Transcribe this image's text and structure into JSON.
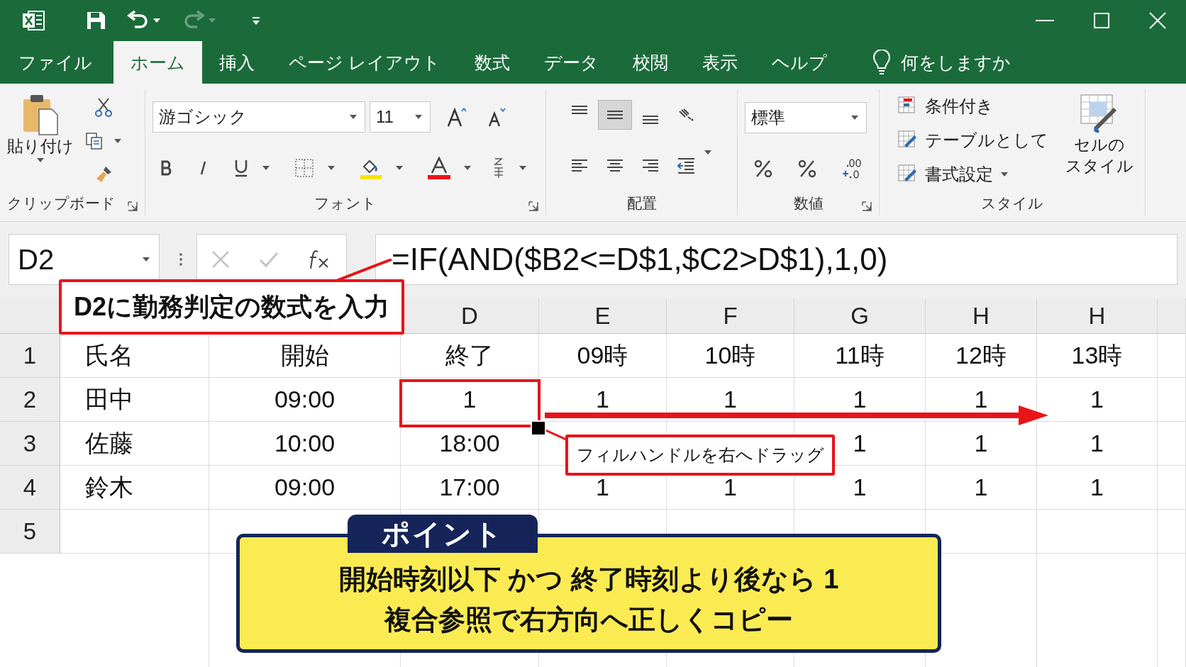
{
  "title_bar": {
    "redo": {
      "disabled": true
    }
  },
  "tabs": [
    {
      "label": "ファイル",
      "selected": false
    },
    {
      "label": "ホーム",
      "selected": true
    },
    {
      "label": "挿入",
      "selected": false
    },
    {
      "label": "ページ レイアウト",
      "selected": false
    },
    {
      "label": "数式",
      "selected": false
    },
    {
      "label": "データ",
      "selected": false
    },
    {
      "label": "校閲",
      "selected": false
    },
    {
      "label": "表示",
      "selected": false
    },
    {
      "label": "ヘルプ",
      "selected": false
    }
  ],
  "tell_me": {
    "placeholder": "何をしますか"
  },
  "ribbon": {
    "clipboard": {
      "paste": "貼り付け",
      "label": "クリップボード"
    },
    "font": {
      "name": "游ゴシック",
      "size": "11",
      "label": "フォント"
    },
    "alignment": {
      "label": "配置",
      "buttons": [
        {
          "kind": "top",
          "selected": false
        },
        {
          "kind": "middle",
          "selected": true
        },
        {
          "kind": "bottom",
          "selected": false
        },
        {
          "kind": "orientation",
          "selected": false
        },
        {
          "kind": "left",
          "selected": false
        },
        {
          "kind": "center",
          "selected": false
        },
        {
          "kind": "right",
          "selected": false
        },
        {
          "kind": "indent",
          "selected": false
        }
      ]
    },
    "number": {
      "format": "標準",
      "label": "数値"
    },
    "styles": {
      "items": [
        "条件付き",
        "テーブルとして",
        "書式設定"
      ],
      "cell_styles": [
        "セルの",
        "スタイル"
      ],
      "label": "スタイル"
    }
  },
  "formula_bar": {
    "name_box": "D2",
    "formula": "=IF(AND($B2<=D$1,$C2>D$1),1,0)"
  },
  "sheet": {
    "column_headers": [
      "D",
      "E",
      "F",
      "G",
      "H",
      "H"
    ],
    "rows": [
      {
        "number": "1",
        "cells": [
          {
            "text": "氏名"
          },
          {
            "text": "開始"
          },
          {
            "text": "終了"
          },
          {
            "text": "09時"
          },
          {
            "text": "10時"
          },
          {
            "text": "11時"
          },
          {
            "text": "12時"
          },
          {
            "text": "13時"
          }
        ]
      },
      {
        "number": "2",
        "cells": [
          {
            "text": "田中"
          },
          {
            "text": "09:00"
          },
          {
            "text": "1"
          },
          {
            "text": "1"
          },
          {
            "text": "1"
          },
          {
            "text": "1"
          },
          {
            "text": "1"
          },
          {
            "text": "1"
          }
        ]
      },
      {
        "number": "3",
        "cells": [
          {
            "text": "佐藤"
          },
          {
            "text": "10:00"
          },
          {
            "text": "18:00"
          },
          {},
          {},
          {
            "text": "1"
          },
          {
            "text": "1"
          },
          {
            "text": "1"
          }
        ]
      },
      {
        "number": "4",
        "cells": [
          {
            "text": "鈴木"
          },
          {
            "text": "09:00"
          },
          {
            "text": "17:00"
          },
          {
            "text": "1"
          },
          {
            "text": "1"
          },
          {
            "text": "1"
          },
          {
            "text": "1"
          },
          {
            "text": "1"
          }
        ]
      },
      {
        "number": "5",
        "cells": []
      }
    ]
  },
  "annotations": {
    "formula_callout": "D2に勤務判定の数式を入力",
    "drag_callout": "フィルハンドルを右へドラッグ",
    "point": {
      "badge": "ポイント",
      "lines": [
        "開始時刻以下 かつ 終了時刻より後なら 1",
        "複合参照で右方向へ正しくコピー"
      ]
    }
  }
}
